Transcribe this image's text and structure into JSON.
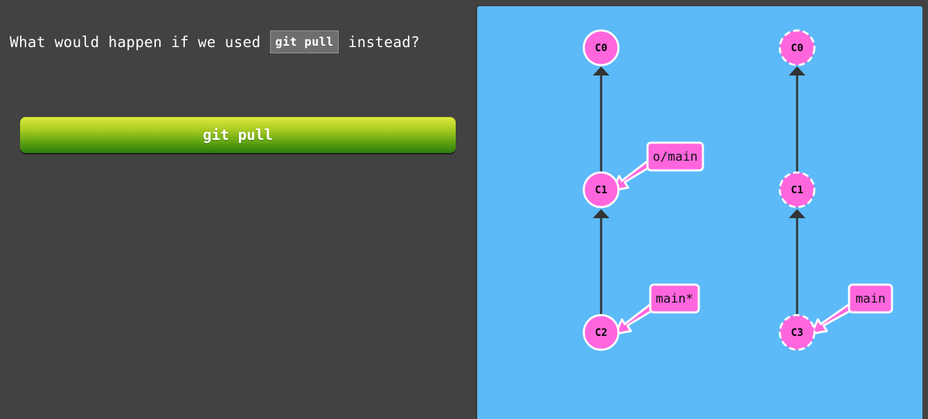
{
  "lesson": {
    "prompt_before": "What would happen if we used",
    "prompt_code": "git pull",
    "prompt_after": "instead?",
    "command_button": "git pull"
  },
  "visualization": {
    "colors": {
      "background": "#5cbaf8",
      "commit_fill": "#ff66dd",
      "commit_stroke": "#ffffff",
      "edge": "#333333",
      "branch_fill": "#ff66dd"
    },
    "local_repo": {
      "commits": [
        {
          "id": "C0",
          "style": "solid"
        },
        {
          "id": "C1",
          "style": "solid"
        },
        {
          "id": "C2",
          "style": "solid"
        }
      ],
      "branches": [
        {
          "label": "o/main",
          "points_to": "C1"
        },
        {
          "label": "main*",
          "points_to": "C2"
        }
      ]
    },
    "remote_repo": {
      "commits": [
        {
          "id": "C0",
          "style": "dashed"
        },
        {
          "id": "C1",
          "style": "dashed"
        },
        {
          "id": "C3",
          "style": "dashed"
        }
      ],
      "branches": [
        {
          "label": "main",
          "points_to": "C3"
        }
      ]
    }
  }
}
